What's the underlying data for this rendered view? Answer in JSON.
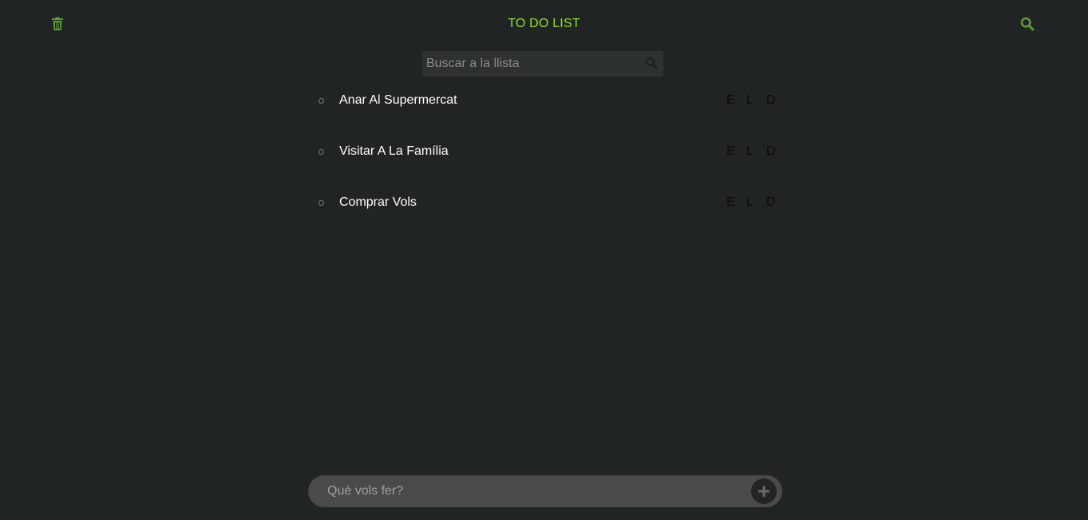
{
  "header": {
    "title": "TO DO LIST",
    "left_icon": "trash-icon",
    "right_icon": "search-icon",
    "accent_color": "#8fe12c",
    "icon_color": "#5a9a3a"
  },
  "search": {
    "placeholder": "Buscar a la llista",
    "value": "",
    "icon": "search-icon"
  },
  "todos": [
    {
      "label": "Anar Al Supermercat",
      "actions": [
        "E",
        "L",
        "D"
      ]
    },
    {
      "label": "Visitar A La Família",
      "actions": [
        "E",
        "L",
        "D"
      ]
    },
    {
      "label": "Comprar Vols",
      "actions": [
        "E",
        "L",
        "D"
      ]
    }
  ],
  "add_bar": {
    "placeholder": "Què vols fer?",
    "value": "",
    "button_icon": "plus-icon"
  }
}
